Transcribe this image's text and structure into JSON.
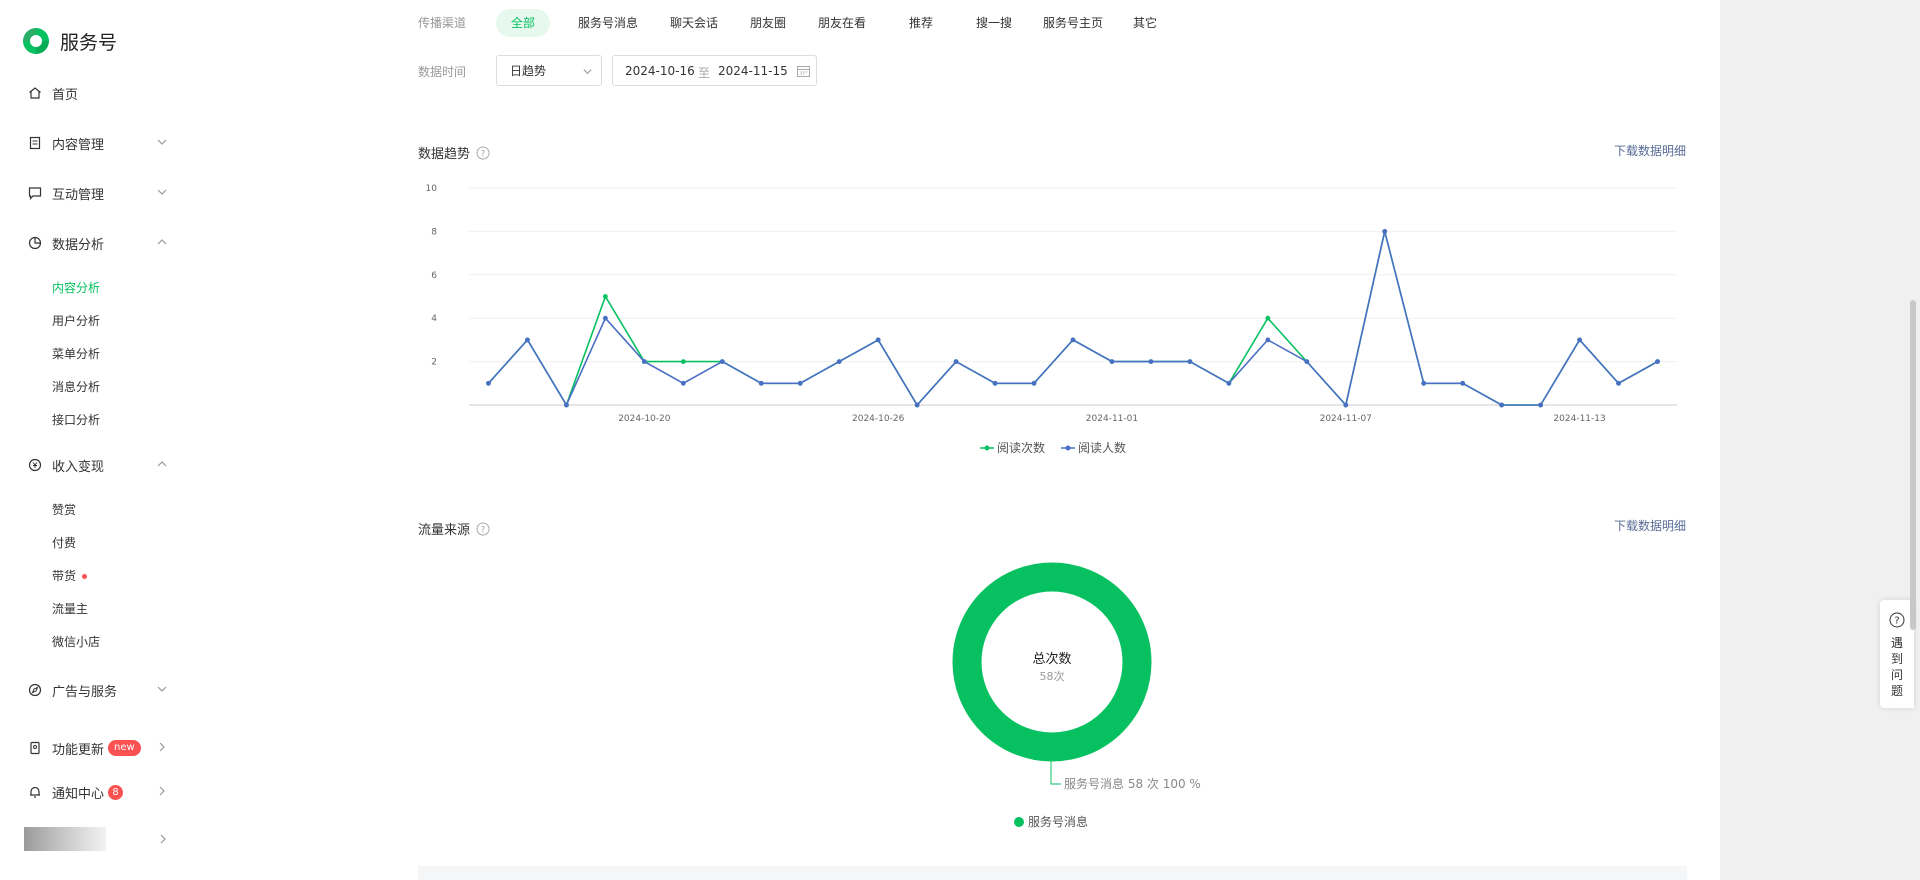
{
  "sidebar": {
    "logo_text": "服务号",
    "home": "首页",
    "content_mgmt": "内容管理",
    "interact_mgmt": "互动管理",
    "data_analysis": "数据分析",
    "data_sub": [
      "内容分析",
      "用户分析",
      "菜单分析",
      "消息分析",
      "接口分析"
    ],
    "income": "收入变现",
    "income_sub": [
      "赞赏",
      "付费",
      "带货",
      "流量主",
      "微信小店"
    ],
    "ads": "广告与服务",
    "updates": "功能更新",
    "updates_badge": "new",
    "notify": "通知中心",
    "notify_badge": "8"
  },
  "filters": {
    "channel_label": "传播渠道",
    "tabs": [
      "全部",
      "服务号消息",
      "聊天会话",
      "朋友圈",
      "朋友在看",
      "推荐",
      "搜一搜",
      "服务号主页",
      "其它"
    ],
    "active_tab": "全部",
    "time_label": "数据时间",
    "granularity": "日趋势",
    "date_from": "2024-10-16",
    "date_sep": "至",
    "date_to": "2024-11-15"
  },
  "trend_section": {
    "title": "数据趋势",
    "download": "下载数据明细"
  },
  "source_section": {
    "title": "流量来源",
    "download": "下载数据明细",
    "total_title": "总次数",
    "total_value": "58次",
    "callout": "服务号消息 58 次 100 %",
    "legend": "服务号消息"
  },
  "help": {
    "text": "遇到问题"
  },
  "colors": {
    "green": "#07c160",
    "blue": "#4a6fc4",
    "link": "#576b95"
  },
  "chart_data": {
    "type": "line",
    "x": [
      "2024-10-16",
      "2024-10-17",
      "2024-10-18",
      "2024-10-19",
      "2024-10-20",
      "2024-10-21",
      "2024-10-22",
      "2024-10-23",
      "2024-10-24",
      "2024-10-25",
      "2024-10-26",
      "2024-10-27",
      "2024-10-28",
      "2024-10-29",
      "2024-10-30",
      "2024-10-31",
      "2024-11-01",
      "2024-11-02",
      "2024-11-03",
      "2024-11-04",
      "2024-11-05",
      "2024-11-06",
      "2024-11-07",
      "2024-11-08",
      "2024-11-09",
      "2024-11-10",
      "2024-11-11",
      "2024-11-12",
      "2024-11-13",
      "2024-11-14",
      "2024-11-15"
    ],
    "x_tick_labels": [
      "2024-10-20",
      "2024-10-26",
      "2024-11-01",
      "2024-11-07",
      "2024-11-13"
    ],
    "y_ticks": [
      "10",
      "8",
      "6",
      "4",
      "2"
    ],
    "ylim": [
      0,
      10
    ],
    "series": [
      {
        "name": "阅读次数",
        "color": "#07c160",
        "values": [
          1,
          3,
          0,
          5,
          2,
          2,
          2,
          1,
          1,
          2,
          3,
          0,
          2,
          1,
          1,
          3,
          2,
          2,
          2,
          1,
          4,
          2,
          0,
          8,
          1,
          1,
          0,
          0,
          3,
          1,
          2
        ]
      },
      {
        "name": "阅读人数",
        "color": "#4a6fc4",
        "values": [
          1,
          3,
          0,
          4,
          2,
          1,
          2,
          1,
          1,
          2,
          3,
          0,
          2,
          1,
          1,
          3,
          2,
          2,
          2,
          1,
          3,
          2,
          0,
          8,
          1,
          1,
          0,
          0,
          3,
          1,
          2
        ]
      }
    ],
    "grid": true,
    "legend_position": "bottom"
  },
  "pie_data": {
    "type": "pie",
    "categories": [
      "服务号消息"
    ],
    "values": [
      58
    ],
    "percent": [
      100
    ]
  }
}
